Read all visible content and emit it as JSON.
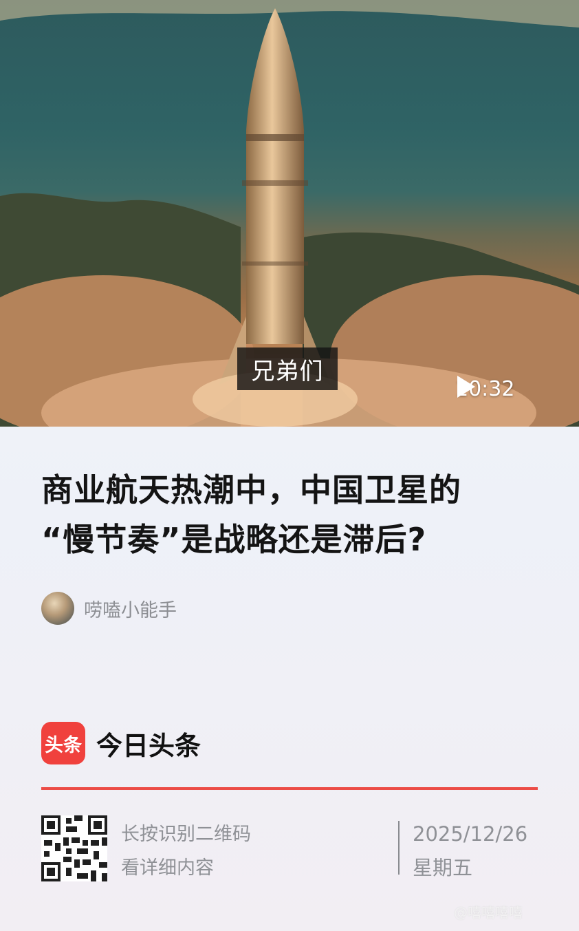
{
  "video": {
    "subtitle": "兄弟们",
    "duration": "10:32"
  },
  "article": {
    "title_line1": "商业航天热潮中，中国卫星的",
    "title_line2": "“慢节奏”是战略还是滞后?",
    "author": "唠嗑小能手"
  },
  "brand": {
    "logo_text": "头条",
    "name": "今日头条",
    "accent_color": "#f0413d"
  },
  "footer": {
    "qr_line1": "长按识别二维码",
    "qr_line2": "看详细内容",
    "date": "2025/12/26",
    "weekday": "星期五"
  },
  "watermark": "@嘻嘻嘻嘻"
}
